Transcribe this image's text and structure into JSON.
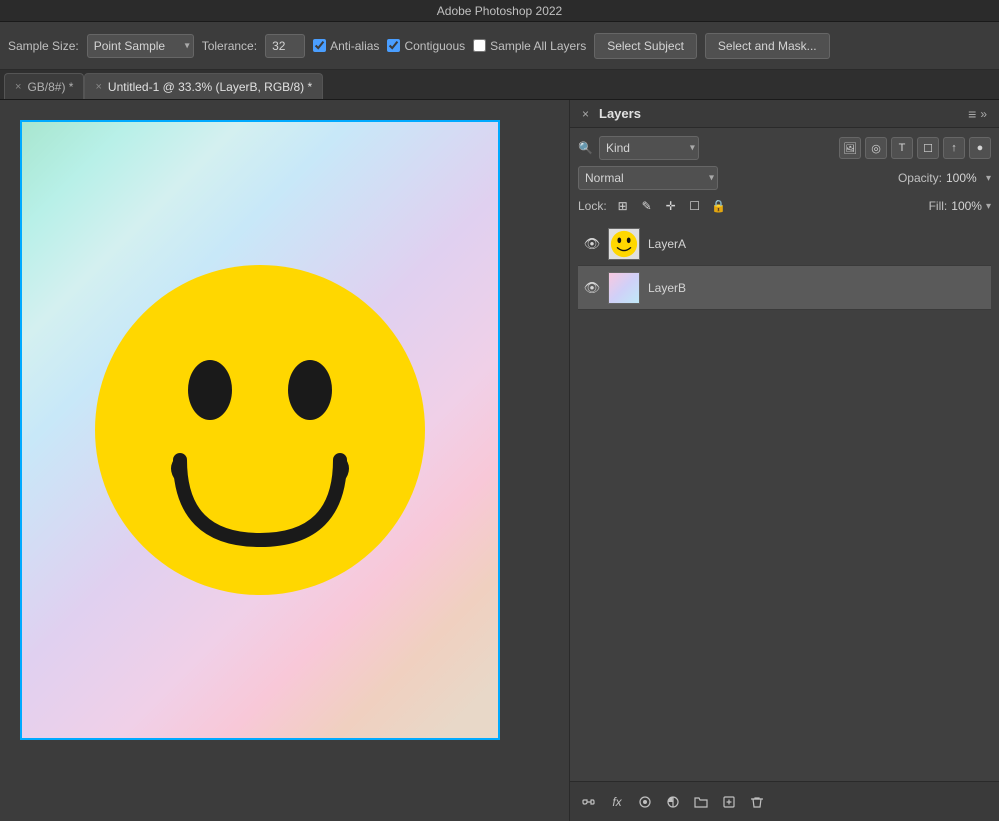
{
  "app": {
    "title": "Adobe Photoshop 2022"
  },
  "toolbar": {
    "sample_size_label": "Sample Size:",
    "sample_size_value": "Point Sample",
    "tolerance_label": "Tolerance:",
    "tolerance_value": "32",
    "anti_alias_label": "Anti-alias",
    "anti_alias_checked": true,
    "contiguous_label": "Contiguous",
    "contiguous_checked": true,
    "sample_all_layers_label": "Sample All Layers",
    "sample_all_layers_checked": false,
    "select_subject_label": "Select Subject",
    "select_and_mask_label": "Select and Mask..."
  },
  "tabs": [
    {
      "id": "tab1",
      "label": "GB/8#) *",
      "active": false,
      "closeable": true
    },
    {
      "id": "tab2",
      "label": "Untitled-1 @ 33.3% (LayerB, RGB/8) *",
      "active": true,
      "closeable": true
    }
  ],
  "layers_panel": {
    "close_btn": "×",
    "collapse_btn": "»",
    "title": "Layers",
    "menu_icon": "≡",
    "filter_label": "Kind",
    "filter_icons": [
      "🖼",
      "◎",
      "T",
      "☐",
      "↑",
      "●"
    ],
    "blend_mode": "Normal",
    "opacity_label": "Opacity:",
    "opacity_value": "100%",
    "lock_label": "Lock:",
    "lock_icons": [
      "⊞",
      "✎",
      "✛",
      "☐",
      "🔒"
    ],
    "fill_label": "Fill:",
    "fill_value": "100%",
    "layers": [
      {
        "id": "layerA",
        "name": "LayerA",
        "visible": true,
        "active": false,
        "thumb": "smiley"
      },
      {
        "id": "layerB",
        "name": "LayerB",
        "visible": true,
        "active": true,
        "thumb": "gradient"
      }
    ],
    "bottom_icons": [
      "🔗",
      "fx",
      "⊙",
      "◎",
      "📁",
      "+",
      "🗑"
    ]
  }
}
